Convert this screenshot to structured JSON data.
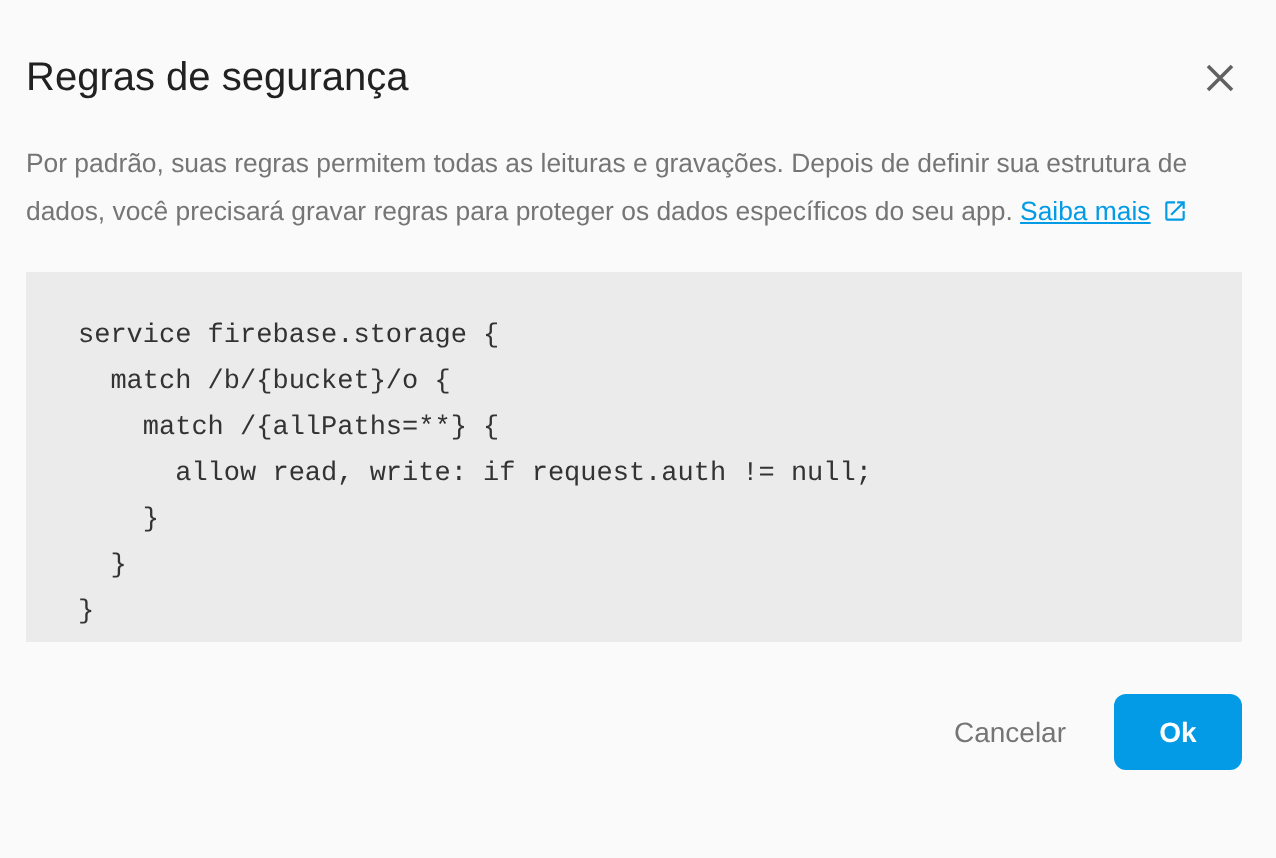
{
  "dialog": {
    "title": "Regras de segurança",
    "description": "Por padrão, suas regras permitem todas as leituras e gravações. Depois de definir sua estrutura de dados, você precisará gravar regras para proteger os dados específicos do seu app.",
    "link": "Saiba mais",
    "code": "service firebase.storage {\n  match /b/{bucket}/o {\n    match /{allPaths=**} {\n      allow read, write: if request.auth != null;\n    }\n  }\n}",
    "buttons": [
      {
        "label": "Cancelar",
        "kind": "text"
      },
      {
        "label": "Ok",
        "kind": "primary"
      }
    ]
  }
}
